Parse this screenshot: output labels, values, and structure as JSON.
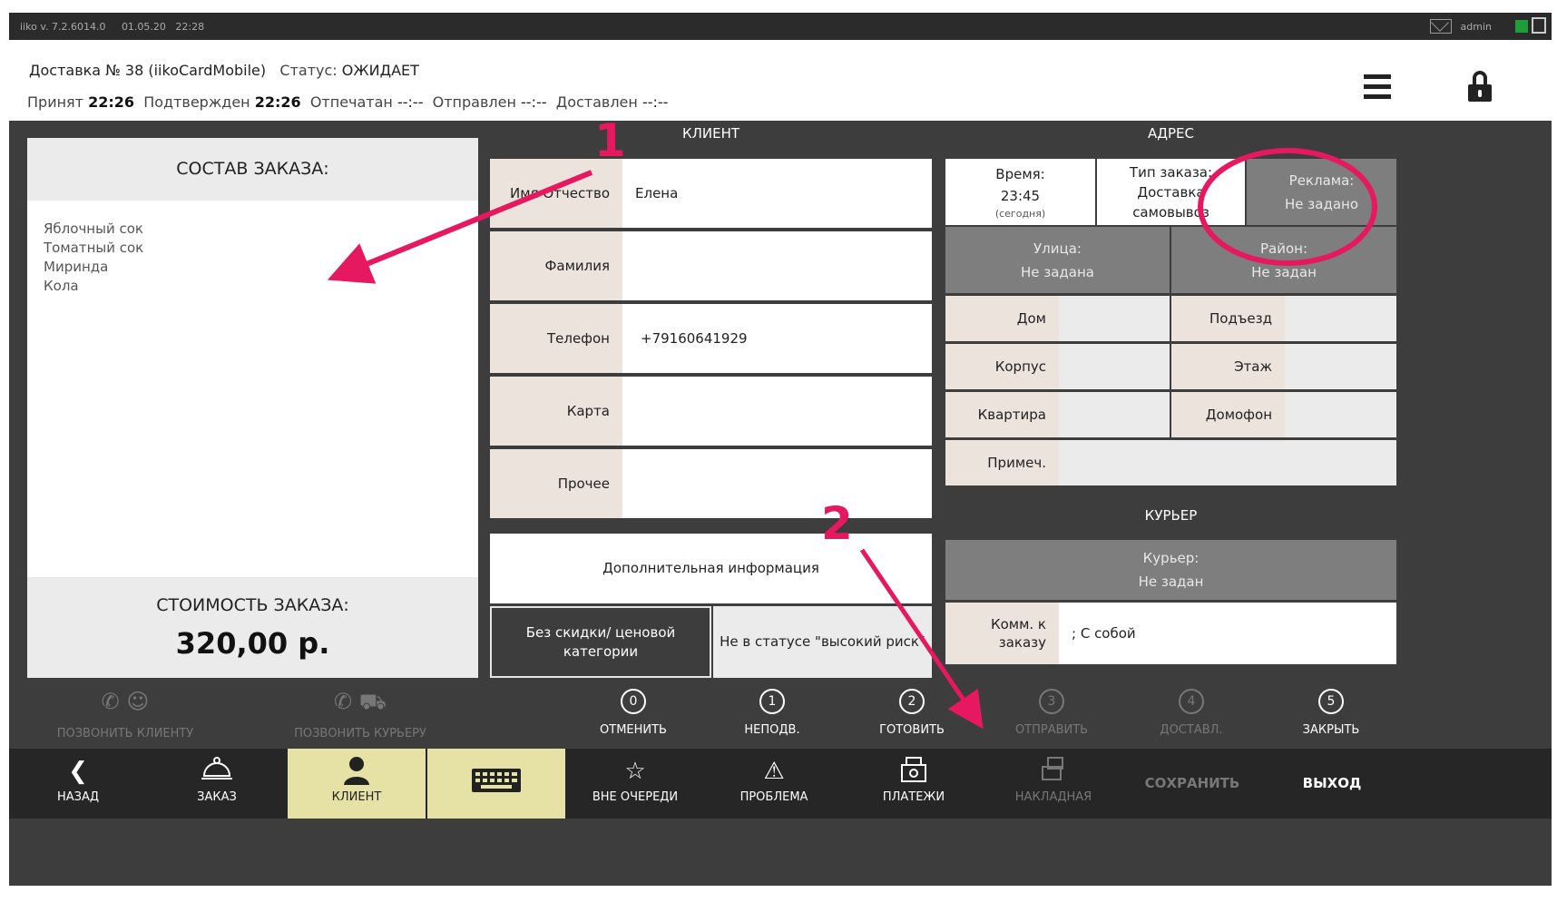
{
  "sysbar": {
    "version": "iiko v. 7.2.6014.0",
    "date": "01.05.20",
    "time": "22:28",
    "user": "admin"
  },
  "header": {
    "title": "Доставка № 38 (iikoCardMobile)",
    "status_label": "Статус:",
    "status_value": "ОЖИДАЕТ",
    "accepted_label": "Принят",
    "accepted_time": "22:26",
    "confirmed_label": "Подтвержден",
    "confirmed_time": "22:26",
    "printed_label": "Отпечатан",
    "printed_time": "--:--",
    "sent_label": "Отправлен",
    "sent_time": "--:--",
    "delivered_label": "Доставлен",
    "delivered_time": "--:--"
  },
  "order": {
    "title": "СОСТАВ ЗАКАЗА:",
    "items": [
      "Яблочный сок",
      "Томатный сок",
      "Миринда",
      "Кола"
    ],
    "cost_label": "СТОИМОСТЬ ЗАКАЗА:",
    "cost_value": "320,00 р."
  },
  "client": {
    "title": "КЛИЕНТ",
    "name_label": "Имя Отчество",
    "name_value": "Елена",
    "surname_label": "Фамилия",
    "surname_value": "",
    "phone_label": "Телефон",
    "phone_value": "+79160641929",
    "card_label": "Карта",
    "card_value": "",
    "other_label": "Прочее",
    "other_value": "",
    "additional_info": "Дополнительная информация",
    "discount_button": "Без скидки/ ценовой категории",
    "risk_button": "Не в статусе \"высокий риск\""
  },
  "address": {
    "title": "АДРЕС",
    "time_label": "Время:",
    "time_value": "23:45",
    "time_note": "(сегодня)",
    "type_label": "Тип заказа:",
    "type_value_1": "Доставка",
    "type_value_2": "самовывоз",
    "ad_label": "Реклама:",
    "ad_value": "Не задано",
    "street_label": "Улица:",
    "street_value": "Не задана",
    "district_label": "Район:",
    "district_value": "Не задан",
    "house_label": "Дом",
    "entrance_label": "Подъезд",
    "building_label": "Корпус",
    "floor_label": "Этаж",
    "flat_label": "Квартира",
    "intercom_label": "Домофон",
    "note_label": "Примеч."
  },
  "courier": {
    "title": "КУРЬЕР",
    "courier_label": "Курьер:",
    "courier_value": "Не задан",
    "comment_label": "Комм. к заказу",
    "comment_value": "; С собой"
  },
  "actions": {
    "call_client": "ПОЗВОНИТЬ КЛИЕНТУ",
    "call_courier": "ПОЗВОНИТЬ КУРЬЕРУ",
    "steps": [
      {
        "num": "0",
        "label": "ОТМЕНИТЬ"
      },
      {
        "num": "1",
        "label": "НЕПОДВ."
      },
      {
        "num": "2",
        "label": "ГОТОВИТЬ"
      },
      {
        "num": "3",
        "label": "ОТПРАВИТЬ"
      },
      {
        "num": "4",
        "label": "ДОСТАВЛ."
      },
      {
        "num": "5",
        "label": "ЗАКРЫТЬ"
      }
    ]
  },
  "nav": {
    "back": "НАЗАД",
    "order": "ЗАКАЗ",
    "client": "КЛИЕНТ",
    "priority": "ВНЕ ОЧЕРЕДИ",
    "problem": "ПРОБЛЕМА",
    "payments": "ПЛАТЕЖИ",
    "invoice": "НАКЛАДНАЯ",
    "save": "СОХРАНИТЬ",
    "exit": "ВЫХОД"
  },
  "annotations": {
    "marker_1": "1",
    "marker_2": "2"
  },
  "colors": {
    "accent": "#e6185f",
    "active_tab": "#e6e2a5",
    "status_green": "#1f9d3a"
  }
}
